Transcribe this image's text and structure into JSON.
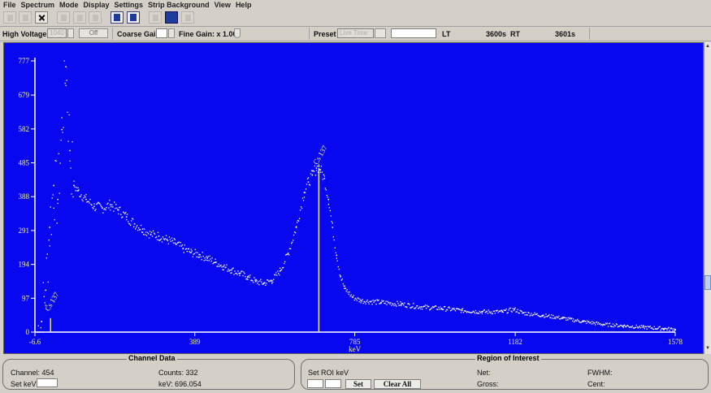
{
  "menu": [
    "File",
    "Spectrum",
    "Mode",
    "Display",
    "Settings",
    "Strip Background",
    "View",
    "Help"
  ],
  "controls": {
    "high_voltage_label": "High Voltage",
    "high_voltage_value": "1040",
    "hv_off_label": "Off",
    "coarse_gain_label": "Coarse Gain",
    "fine_gain_label": "Fine Gain: x 1.00",
    "preset_label": "Preset",
    "preset_value": "Live Time",
    "lt_label": "LT",
    "lt_value": "3600s",
    "rt_label": "RT",
    "rt_value": "3601s"
  },
  "colors": {
    "plot_bg": "#0808f0",
    "plot_fg": "#ffffff",
    "label_color": "#f0f0a0"
  },
  "chart_data": {
    "type": "scatter",
    "x_unit": "keV",
    "xlabel": "keV",
    "xlim": [
      -6.6,
      1578
    ],
    "ylim": [
      0,
      777
    ],
    "x_ticks": [
      "-6.6",
      "389",
      "785",
      "1182",
      "1578"
    ],
    "y_ticks": [
      "777",
      "679",
      "582",
      "485",
      "388",
      "291",
      "194",
      "97",
      "0"
    ],
    "cursor_kev": 696.054,
    "annotations": [
      {
        "text": "Cs 137",
        "x": 696,
        "y": 460
      },
      {
        "text": "Cs 137",
        "x": 32,
        "y": 40
      }
    ],
    "series": [
      {
        "x": [
          0,
          10,
          20,
          30,
          40,
          50,
          60,
          70,
          80,
          90,
          100,
          120,
          140,
          160,
          180,
          200,
          220,
          240,
          260,
          280,
          300,
          320,
          340,
          360,
          380,
          400,
          420,
          440,
          460,
          480,
          500,
          520,
          540,
          560,
          580,
          600,
          620,
          640,
          660,
          670,
          680,
          690,
          696,
          700,
          710,
          720,
          730,
          740,
          750,
          760,
          780,
          800,
          850,
          900,
          950,
          1000,
          1050,
          1100,
          1150,
          1180,
          1200,
          1250,
          1300,
          1350,
          1400,
          1450,
          1500,
          1550,
          1578
        ],
        "y": [
          0,
          30,
          120,
          300,
          420,
          380,
          580,
          760,
          520,
          420,
          405,
          380,
          360,
          355,
          365,
          350,
          330,
          310,
          295,
          280,
          275,
          265,
          255,
          240,
          228,
          222,
          212,
          200,
          188,
          178,
          168,
          158,
          145,
          140,
          148,
          175,
          225,
          300,
          400,
          430,
          450,
          470,
          475,
          465,
          440,
          380,
          300,
          220,
          160,
          125,
          100,
          90,
          85,
          80,
          72,
          68,
          62,
          58,
          58,
          65,
          55,
          48,
          40,
          30,
          22,
          18,
          14,
          10,
          8
        ]
      }
    ]
  },
  "channel_data": {
    "title": "Channel Data",
    "channel_label": "Channel: 454",
    "counts_label": "Counts: 332",
    "set_kev_label": "Set keV",
    "kev_label": "keV: 696.054"
  },
  "roi": {
    "title": "Region of Interest",
    "set_roi_label": "Set ROI keV",
    "set_button": "Set",
    "clear_all_button": "Clear All",
    "net_label": "Net:",
    "gross_label": "Gross:",
    "fwhm_label": "FWHM:",
    "cent_label": "Cent:"
  }
}
